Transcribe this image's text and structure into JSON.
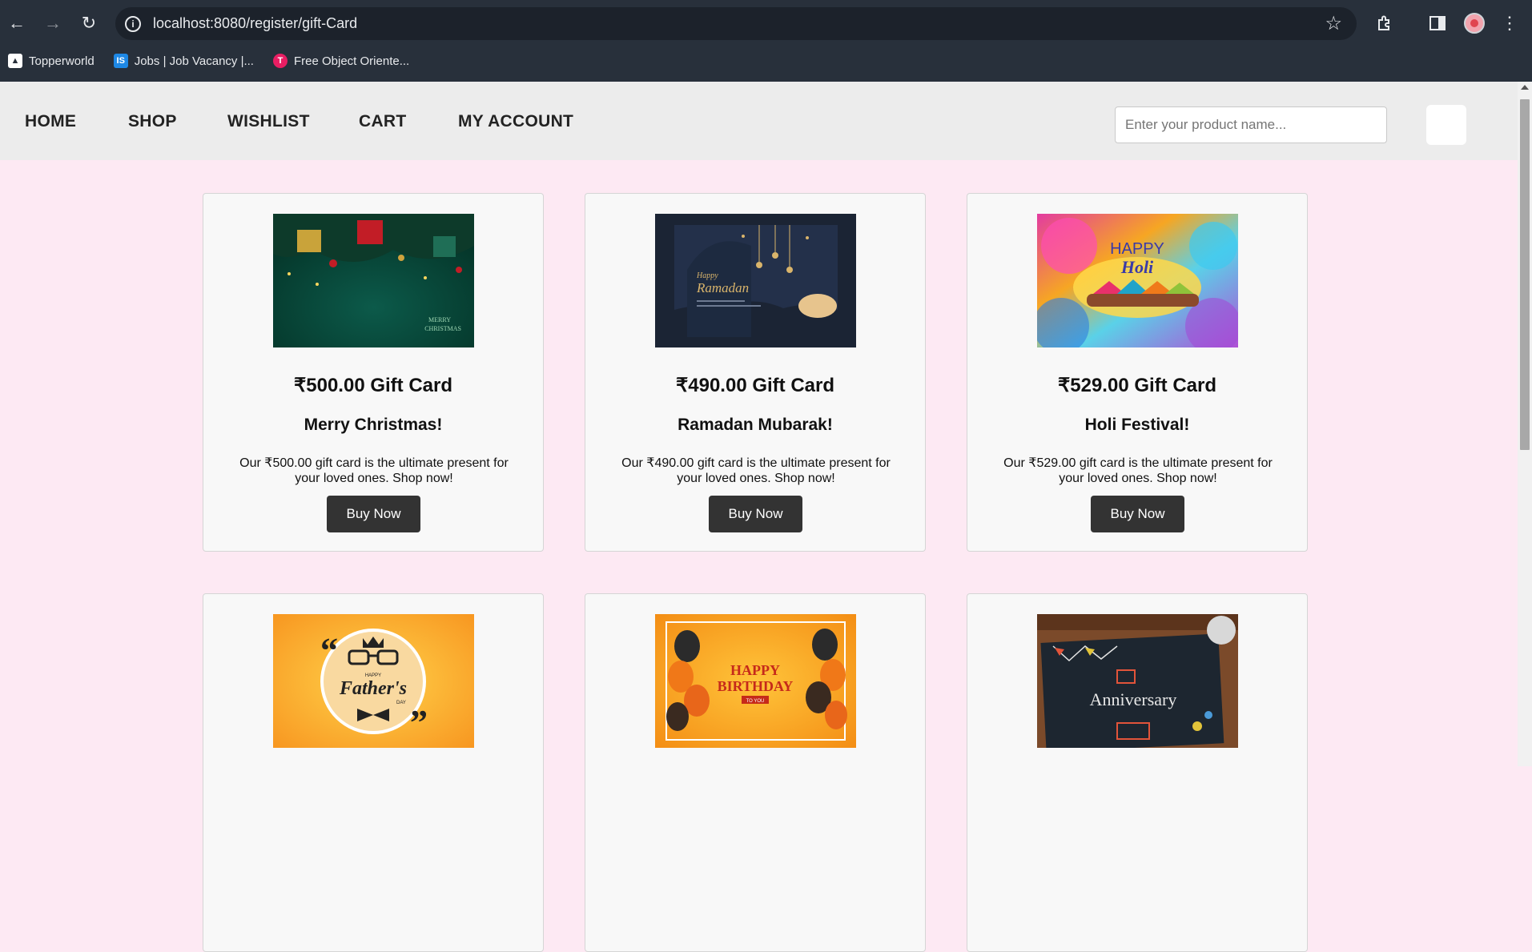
{
  "browser": {
    "url": "localhost:8080/register/gift-Card",
    "bookmarks": [
      {
        "label": "Topperworld"
      },
      {
        "label": "Jobs | Job Vacancy |..."
      },
      {
        "label": "Free Object Oriente..."
      }
    ]
  },
  "site": {
    "nav": [
      "HOME",
      "SHOP",
      "WISHLIST",
      "CART",
      "MY ACCOUNT"
    ],
    "search_placeholder": "Enter your product name..."
  },
  "cards": [
    {
      "price": "₹500.00 Gift Card",
      "occasion": "Merry Christmas!",
      "description": "Our ₹500.00 gift card is the ultimate present for your loved ones. Shop now!",
      "button": "Buy Now",
      "image_text": [
        "MERRY",
        "CHRISTMAS"
      ]
    },
    {
      "price": "₹490.00 Gift Card",
      "occasion": "Ramadan Mubarak!",
      "description": "Our ₹490.00 gift card is the ultimate present for your loved ones. Shop now!",
      "button": "Buy Now",
      "image_text": [
        "Happy",
        "Ramadan"
      ]
    },
    {
      "price": "₹529.00 Gift Card",
      "occasion": "Holi Festival!",
      "description": "Our ₹529.00 gift card is the ultimate present for your loved ones. Shop now!",
      "button": "Buy Now",
      "image_text": [
        "HAPPY",
        "Holi"
      ]
    },
    {
      "image_text": [
        "HAPPY",
        "Father's",
        "DAY"
      ]
    },
    {
      "image_text": [
        "HAPPY",
        "BIRTHDAY",
        "TO YOU"
      ]
    },
    {
      "image_text": [
        "Anniversary"
      ]
    }
  ]
}
